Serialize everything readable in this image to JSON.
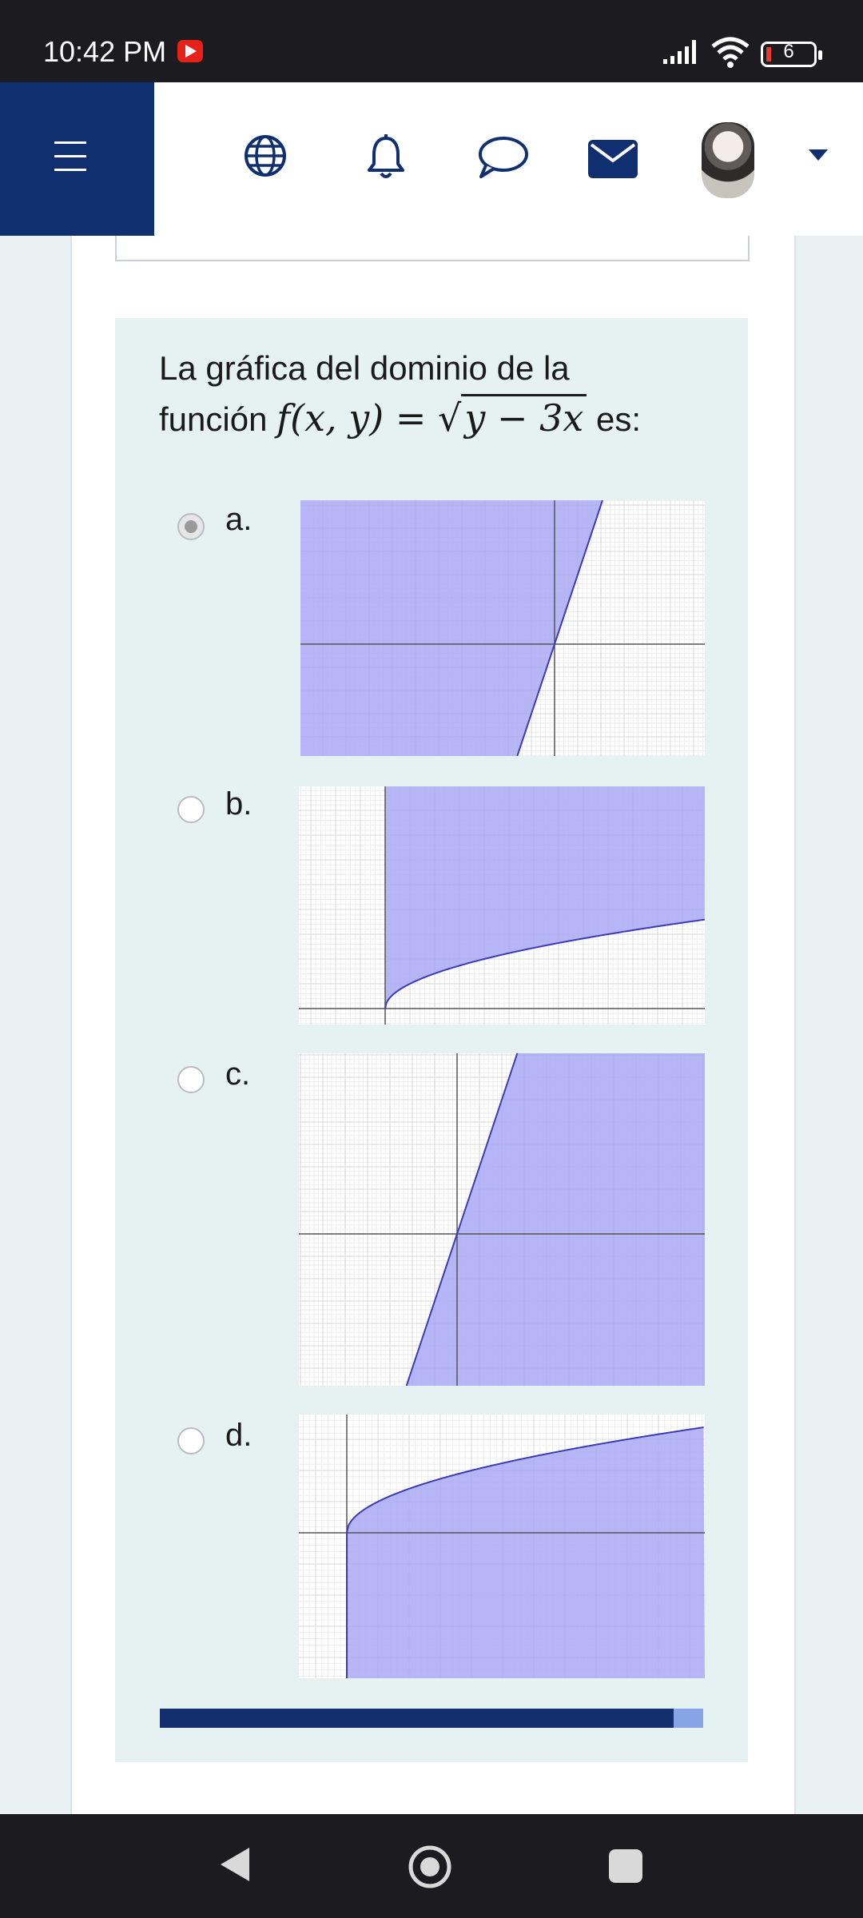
{
  "status_bar": {
    "time": "10:42 PM",
    "battery": "6"
  },
  "question": {
    "text_before": "La gráfica del dominio de la",
    "text_funcion": "función",
    "math_lhs": "f(x, y) = ",
    "math_radicand": "y − 3x",
    "text_after": "es:",
    "options": [
      {
        "label": "a.",
        "selected": true
      },
      {
        "label": "b.",
        "selected": false
      },
      {
        "label": "c.",
        "selected": false
      },
      {
        "label": "d.",
        "selected": false
      }
    ]
  },
  "progress_fraction": 0.945,
  "colors": {
    "brand": "#0f2f70",
    "shade": "#a9a9f6",
    "curve": "#3b3bb8",
    "panel": "#e6f1f2"
  },
  "icons": [
    "menu-icon",
    "globe-icon",
    "bell-icon",
    "chat-icon",
    "mail-icon",
    "user-avatar",
    "caret-down-icon",
    "back-icon",
    "home-icon",
    "recents-icon"
  ]
}
